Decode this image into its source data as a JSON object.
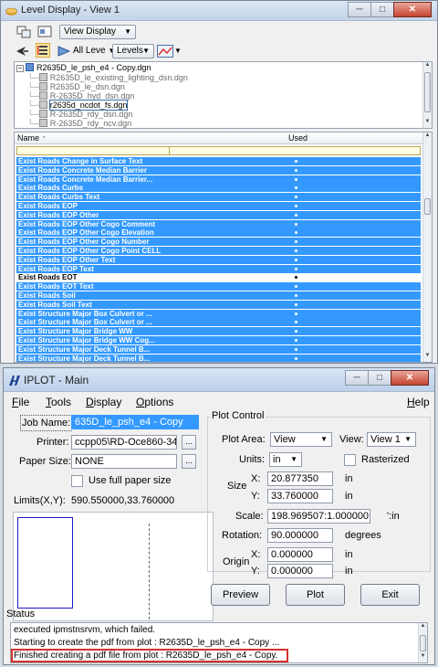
{
  "level_display": {
    "title": "Level Display - View 1",
    "view_display_dropdown": "View Display",
    "all_levels_dropdown": "All Leve",
    "levels_dropdown": "Levels",
    "tree": {
      "root": "R2635D_le_psh_e4 - Copy.dgn",
      "children": [
        "R2635D_le_existing_lighting_dsn.dgn",
        "R2635D_le_dsn.dgn",
        "R-2635D_hyd_dsn.dgn",
        "r2635d_ncdot_fs.dgn",
        "R-2635D_rdy_dsn.dgn",
        "R-2635D_rdy_ncv.dgn"
      ],
      "selected_index": 3
    },
    "columns": {
      "name": "Name",
      "used": "Used"
    },
    "rows": [
      "Exist Roads Change in Surface Text",
      "Exist Roads Concrete Median Barrier",
      "Exist Roads Concrete Median Barrier...",
      "Exist Roads Curbs",
      "Exist Roads Curbs Text",
      "Exist Roads EOP",
      "Exist Roads EOP Other",
      "Exist Roads EOP Other Cogo Comment",
      "Exist Roads EOP Other Cogo Elevation",
      "Exist Roads EOP Other Cogo Number",
      "Exist Roads EOP Other Cogo Point CELL",
      "Exist Roads EOP Other Text",
      "Exist Roads EOP Text",
      "Exist Roads EOT",
      "Exist Roads EOT Text",
      "Exist Roads Soil",
      "Exist Roads Soil Text",
      "Exist Structure Major Box Culvert or ...",
      "Exist Structure Major Box Culvert or ...",
      "Exist Structure Major Bridge WW",
      "Exist Structure Major Bridge WW Cog...",
      "Exist Structure Major Deck Tunnel B...",
      "Exist Structure Major Deck Tunnel B..."
    ],
    "selected_row": 13
  },
  "iplot": {
    "title": "IPLOT - Main",
    "menu": {
      "file": "File",
      "tools": "Tools",
      "display": "Display",
      "options": "Options",
      "help": "Help"
    },
    "job_name_label": "Job Name:",
    "job_name_value": "635D_le_psh_e4 - Copy",
    "printer_label": "Printer:",
    "printer_value": "ccpp05\\RD-Oce860-34",
    "paper_size_label": "Paper Size:",
    "paper_size_value": "NONE",
    "ellipsis": "...",
    "use_full_paper_label": "Use full paper size",
    "limits_label": "Limits(X,Y):",
    "limits_value": "590.550000,33.760000",
    "plot_control_label": "Plot Control",
    "plot_area_label": "Plot Area:",
    "plot_area_value": "View",
    "view_label": "View:",
    "view_value": "View 1",
    "units_label": "Units:",
    "units_value": "in",
    "rasterized_label": "Rasterized",
    "size_label": "Size",
    "x_label": "X:",
    "y_label": "Y:",
    "size_x": "20.877350",
    "size_y": "33.760000",
    "unit_in": "in",
    "scale_label": "Scale:",
    "scale_value": "198.969507:1.000000",
    "scale_unit": "':in",
    "rotation_label": "Rotation:",
    "rotation_value": "90.000000",
    "rotation_unit": "degrees",
    "origin_label": "Origin",
    "origin_x": "0.000000",
    "origin_y": "0.000000",
    "preview_button": "Preview",
    "plot_button": "Plot",
    "exit_button": "Exit",
    "status_label": "Status",
    "status_lines": [
      "executed ipmstnsrvm, which failed.",
      "Starting to create the pdf from plot : R2635D_le_psh_e4 - Copy ...",
      "Finished creating a pdf file from plot : R2635D_le_psh_e4 - Copy."
    ]
  },
  "colors": {
    "selection": "#3399ff",
    "highlight_box": "#d6312c"
  }
}
